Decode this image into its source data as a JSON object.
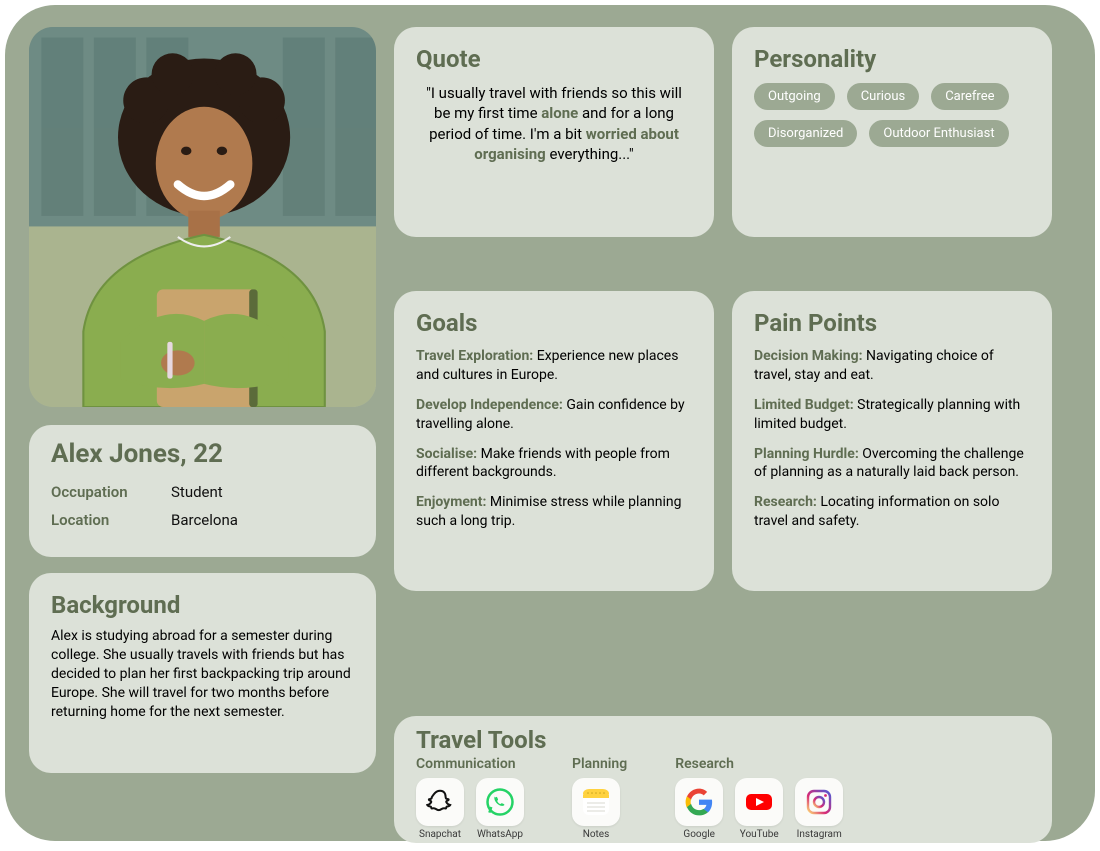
{
  "identity": {
    "name_line": "Alex Jones, 22",
    "occupation_label": "Occupation",
    "occupation_value": "Student",
    "location_label": "Location",
    "location_value": "Barcelona"
  },
  "background": {
    "heading": "Background",
    "text": "Alex is studying abroad for a semester during college. She usually travels with friends but has decided to plan her first backpacking trip around Europe. She will travel for two months before returning home for the next semester."
  },
  "quote": {
    "heading": "Quote",
    "pre": "\"I usually travel with friends so this will be my first time ",
    "em1": "alone",
    "mid": " and for a long period of time. I'm a bit ",
    "em2": "worried about organising",
    "post": " everything...\""
  },
  "personality": {
    "heading": "Personality",
    "traits": [
      "Outgoing",
      "Curious",
      "Carefree",
      "Disorganized",
      "Outdoor Enthusiast"
    ]
  },
  "goals": {
    "heading": "Goals",
    "items": [
      {
        "label": "Travel Exploration:",
        "text": " Experience new places and cultures in Europe."
      },
      {
        "label": "Develop Independence:",
        "text": " Gain confidence by travelling alone."
      },
      {
        "label": "Socialise:",
        "text": " Make friends with people from different backgrounds."
      },
      {
        "label": "Enjoyment:",
        "text": " Minimise stress while planning such a long trip."
      }
    ]
  },
  "painpoints": {
    "heading": "Pain Points",
    "items": [
      {
        "label": "Decision Making:",
        "text": " Navigating choice of travel, stay and eat."
      },
      {
        "label": "Limited Budget:",
        "text": " Strategically planning with limited budget."
      },
      {
        "label": "Planning Hurdle:",
        "text": " Overcoming the challenge of planning as a naturally laid back person."
      },
      {
        "label": "Research:",
        "text": " Locating information on solo travel and safety."
      }
    ]
  },
  "tools": {
    "heading": "Travel Tools",
    "groups": [
      {
        "label": "Communication",
        "apps": [
          {
            "name": "Snapchat",
            "icon": "snapchat"
          },
          {
            "name": "WhatsApp",
            "icon": "whatsapp"
          }
        ]
      },
      {
        "label": "Planning",
        "apps": [
          {
            "name": "Notes",
            "icon": "notes"
          }
        ]
      },
      {
        "label": "Research",
        "apps": [
          {
            "name": "Google",
            "icon": "google"
          },
          {
            "name": "YouTube",
            "icon": "youtube"
          },
          {
            "name": "Instagram",
            "icon": "instagram"
          }
        ]
      }
    ]
  },
  "colors": {
    "accent": "#5f6d52",
    "card": "#dce1d8",
    "canvas": "#9ca993"
  }
}
